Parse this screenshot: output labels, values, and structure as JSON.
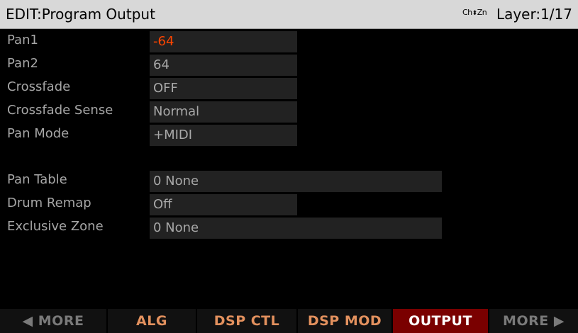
{
  "header": {
    "title": "EDIT:Program Output",
    "chzn_icon_text": "Ch",
    "chzn_icon_text2": "Zn",
    "layer": "Layer:1/17"
  },
  "parameters": [
    {
      "label": "Pan1",
      "value": "-64",
      "active": true
    },
    {
      "label": "Pan2",
      "value": "64"
    },
    {
      "label": "Crossfade",
      "value": "OFF"
    },
    {
      "label": "Crossfade Sense",
      "value": "Normal"
    },
    {
      "label": "Pan Mode",
      "value": "+MIDI"
    },
    {
      "label": "Pan Table",
      "value": "0 None"
    },
    {
      "label": "Drum Remap",
      "value": "Off"
    },
    {
      "label": "Exclusive Zone",
      "value": "0 None"
    }
  ],
  "softkeys": [
    {
      "label": "◀ MORE",
      "state": "dim"
    },
    {
      "label": "ALG",
      "state": "normal"
    },
    {
      "label": "DSP CTL",
      "state": "normal"
    },
    {
      "label": "DSP MOD",
      "state": "normal"
    },
    {
      "label": "OUTPUT",
      "state": "selected"
    },
    {
      "label": "MORE ▶",
      "state": "dim"
    }
  ]
}
